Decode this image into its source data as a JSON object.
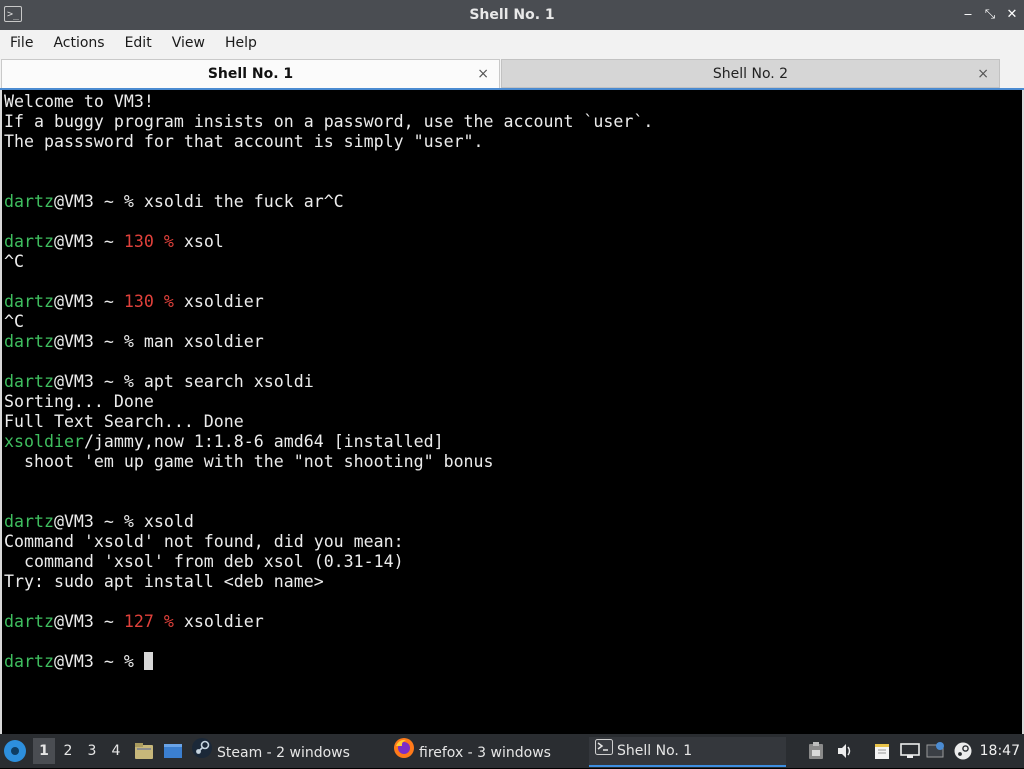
{
  "window": {
    "title": "Shell No. 1",
    "minimize_glyph": "‒",
    "maximize_glyph": "⤡",
    "close_glyph": "✕"
  },
  "menu": [
    "File",
    "Actions",
    "Edit",
    "View",
    "Help"
  ],
  "tabs": [
    {
      "label": "Shell No. 1",
      "close": "×",
      "active": true
    },
    {
      "label": "Shell No. 2",
      "close": "×",
      "active": false
    }
  ],
  "terminal": {
    "lines": [
      [
        {
          "t": "Welcome to VM3!"
        }
      ],
      [
        {
          "t": "If a buggy program insists on a password, use the account `user`."
        }
      ],
      [
        {
          "t": "The passsword for that account is simply \"user\"."
        }
      ],
      [],
      [],
      [
        {
          "t": "dartz",
          "c": "prompt-user"
        },
        {
          "t": "@VM3 ~ % xsoldi the fuck ar^C"
        }
      ],
      [],
      [
        {
          "t": "dartz",
          "c": "prompt-user"
        },
        {
          "t": "@VM3 ~ "
        },
        {
          "t": "130 %",
          "c": "exit-code"
        },
        {
          "t": " xsol"
        }
      ],
      [
        {
          "t": "^C"
        }
      ],
      [],
      [
        {
          "t": "dartz",
          "c": "prompt-user"
        },
        {
          "t": "@VM3 ~ "
        },
        {
          "t": "130 %",
          "c": "exit-code"
        },
        {
          "t": " xsoldier"
        }
      ],
      [
        {
          "t": "^C"
        }
      ],
      [
        {
          "t": "dartz",
          "c": "prompt-user"
        },
        {
          "t": "@VM3 ~ % man xsoldier"
        }
      ],
      [],
      [
        {
          "t": "dartz",
          "c": "prompt-user"
        },
        {
          "t": "@VM3 ~ % apt search xsoldi"
        }
      ],
      [
        {
          "t": "Sorting... Done"
        }
      ],
      [
        {
          "t": "Full Text Search... Done"
        }
      ],
      [
        {
          "t": "xsoldier",
          "c": "pkg-name"
        },
        {
          "t": "/jammy,now 1:1.8-6 amd64 [installed]"
        }
      ],
      [
        {
          "t": "  shoot 'em up game with the \"not shooting\" bonus"
        }
      ],
      [],
      [],
      [
        {
          "t": "dartz",
          "c": "prompt-user"
        },
        {
          "t": "@VM3 ~ % xsold"
        }
      ],
      [
        {
          "t": "Command 'xsold' not found, did you mean:"
        }
      ],
      [
        {
          "t": "  command 'xsol' from deb xsol (0.31-14)"
        }
      ],
      [
        {
          "t": "Try: sudo apt install <deb name>"
        }
      ],
      [],
      [
        {
          "t": "dartz",
          "c": "prompt-user"
        },
        {
          "t": "@VM3 ~ "
        },
        {
          "t": "127 %",
          "c": "exit-code"
        },
        {
          "t": " xsoldier"
        }
      ],
      [],
      [
        {
          "t": "dartz",
          "c": "prompt-user"
        },
        {
          "t": "@VM3 ~ % "
        },
        {
          "cursor": true
        }
      ]
    ]
  },
  "taskbar": {
    "workspaces": [
      "1",
      "2",
      "3",
      "4"
    ],
    "active_workspace": "1",
    "tasks": [
      {
        "label": "Steam - 2 windows",
        "icon": "steam-icon"
      },
      {
        "label": "firefox - 3 windows",
        "icon": "firefox-icon"
      },
      {
        "label": "Shell No. 1",
        "icon": "terminal-icon",
        "active": true
      }
    ],
    "clock": "18:47"
  },
  "colors": {
    "prompt_user": "#3fbf5f",
    "exit_code": "#e0413b",
    "tab_accent": "#4b8bd1",
    "taskbar_bg": "#2a2d31"
  }
}
